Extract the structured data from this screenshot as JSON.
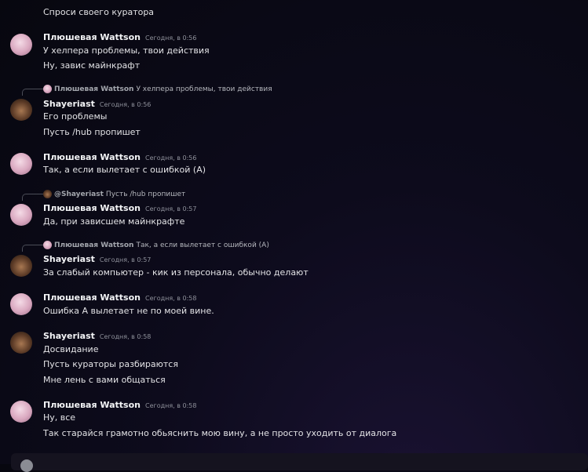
{
  "chat": {
    "top_message": "Спроси своего куратора",
    "groups": [
      {
        "author": "Плюшевая Wattson",
        "time": "Сегодня, в 0:56",
        "lines": [
          "У хелпера проблемы, твои действия",
          "Ну, завис майнкрафт"
        ]
      },
      {
        "reply_to": {
          "author": "Плюшевая Wattson",
          "text": "У хелпера проблемы, твои действия"
        },
        "author": "Shayeriast",
        "time": "Сегодня, в 0:56",
        "lines": [
          "Его проблемы",
          "Пусть /hub пропишет"
        ]
      },
      {
        "author": "Плюшевая Wattson",
        "time": "Сегодня, в 0:56",
        "lines": [
          "Так, а если вылетает с ошибкой (А)"
        ]
      },
      {
        "reply_to": {
          "author": "@Shayeriast",
          "text": "Пусть /hub пропишет"
        },
        "author": "Плюшевая Wattson",
        "time": "Сегодня, в 0:57",
        "lines": [
          "Да, при зависшем майнкрафте"
        ]
      },
      {
        "reply_to": {
          "author": "Плюшевая Wattson",
          "text": "Так, а если вылетает с ошибкой (А)"
        },
        "author": "Shayeriast",
        "time": "Сегодня, в 0:57",
        "lines": [
          "За слабый компьютер - кик из персонала, обычно делают"
        ]
      },
      {
        "author": "Плюшевая Wattson",
        "time": "Сегодня, в 0:58",
        "lines": [
          "Ошибка А вылетает не по моей вине."
        ]
      },
      {
        "author": "Shayeriast",
        "time": "Сегодня, в 0:58",
        "lines": [
          "Досвидание",
          "Пусть кураторы разбираются",
          "Мне лень с вами общаться"
        ]
      },
      {
        "author": "Плюшевая Wattson",
        "time": "Сегодня, в 0:58",
        "lines": [
          "Ну, все",
          "Так старайся грамотно обьяснить мою вину, а не просто уходить от диалога"
        ]
      }
    ]
  }
}
